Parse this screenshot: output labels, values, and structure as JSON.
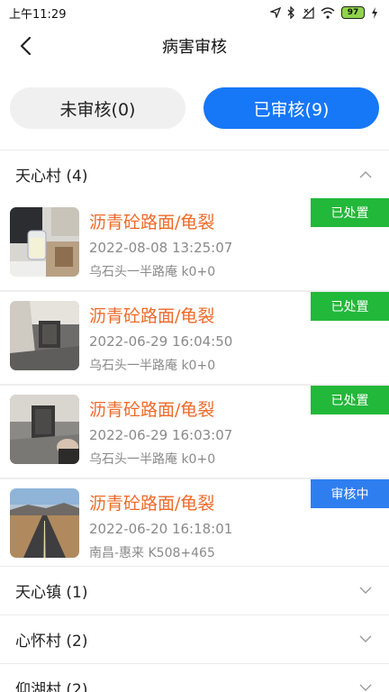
{
  "status_bar": {
    "time": "上午11:29",
    "battery": "97"
  },
  "header": {
    "title": "病害审核"
  },
  "tabs": [
    {
      "label": "未审核(0)",
      "active": false
    },
    {
      "label": "已审核(9)",
      "active": true
    }
  ],
  "groups": [
    {
      "name": "天心村 (4)",
      "expanded": true
    },
    {
      "name": "天心镇 (1)",
      "expanded": false
    },
    {
      "name": "心怀村 (2)",
      "expanded": false
    },
    {
      "name": "仰湖村 (2)",
      "expanded": false
    }
  ],
  "records": [
    {
      "title": "沥青砼路面/龟裂",
      "time": "2022-08-08 13:25:07",
      "location": "乌石头一半路庵 k0+0",
      "status": "已处置",
      "status_color": "#22b83a"
    },
    {
      "title": "沥青砼路面/龟裂",
      "time": "2022-06-29 16:04:50",
      "location": "乌石头一半路庵 k0+0",
      "status": "已处置",
      "status_color": "#22b83a"
    },
    {
      "title": "沥青砼路面/龟裂",
      "time": "2022-06-29 16:03:07",
      "location": "乌石头一半路庵 k0+0",
      "status": "已处置",
      "status_color": "#22b83a"
    },
    {
      "title": "沥青砼路面/龟裂",
      "time": "2022-06-20 16:18:01",
      "location": "南昌-惠来 K508+465",
      "status": "审核中",
      "status_color": "#2f7ef0"
    }
  ],
  "colors": {
    "accent": "#1677f7",
    "title_orange": "#ee6a28",
    "disposed_green": "#22b83a",
    "reviewing_blue": "#2f7ef0"
  }
}
